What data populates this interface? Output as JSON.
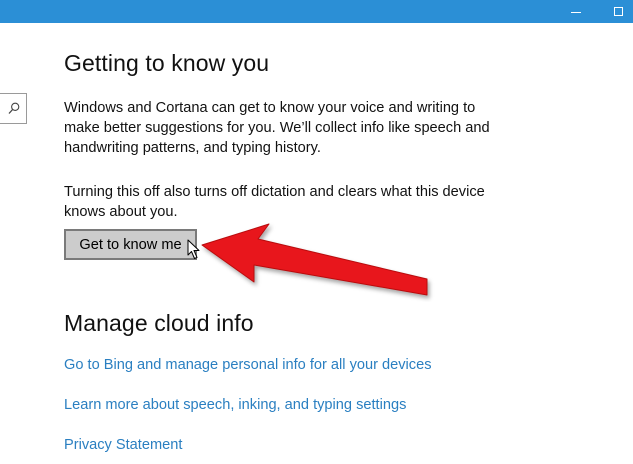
{
  "window": {
    "titlebar_color": "#2b8fd6",
    "controls": [
      "minimize-icon",
      "maximize-icon"
    ]
  },
  "sidebar": {
    "search_icon": "search-icon"
  },
  "getting_to_know": {
    "title": "Getting to know you",
    "description_lines": [
      "Windows and Cortana can get to know your voice and writing to",
      "make better suggestions for you. We’ll collect info like speech and",
      "handwriting patterns, and typing history."
    ],
    "note_lines": [
      "Turning this off also turns off dictation and clears what this device",
      "knows about you."
    ],
    "button_label": "Get to know me"
  },
  "cloud_info": {
    "title": "Manage cloud info",
    "links": [
      "Go to Bing and manage personal info for all your devices",
      "Learn more about speech, inking, and typing settings",
      "Privacy Statement"
    ]
  },
  "colors": {
    "link": "#2a7fc1",
    "annotation_arrow": "#e8141a",
    "button_bg": "#cccccc"
  }
}
